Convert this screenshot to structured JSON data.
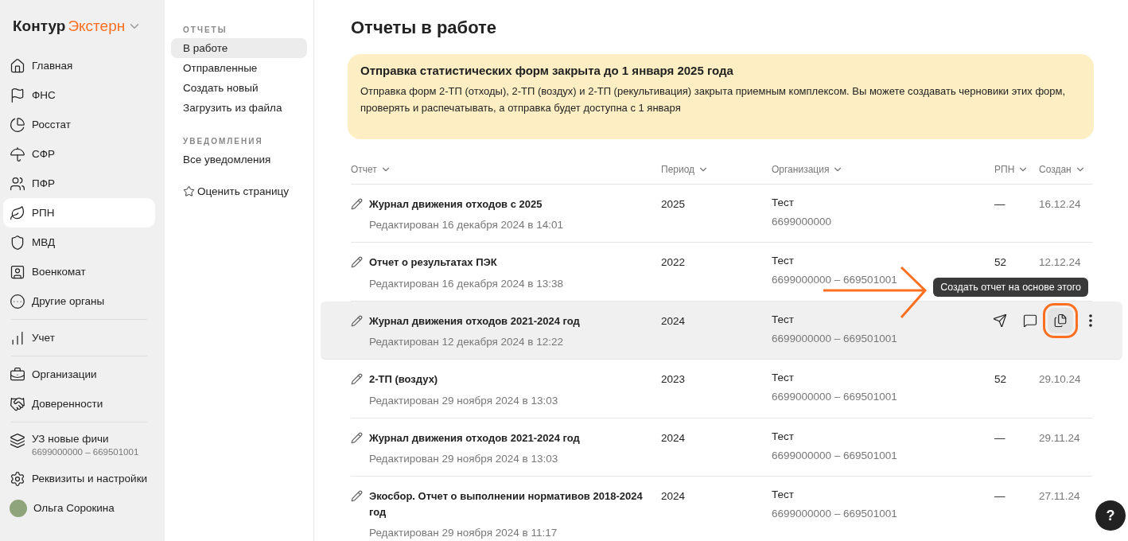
{
  "logo": {
    "brand": "Контур",
    "product": "Экстерн"
  },
  "sidebar": {
    "items": [
      {
        "kind": "link",
        "label": "Главная",
        "selected": false
      },
      {
        "kind": "link",
        "label": "ФНС",
        "selected": false
      },
      {
        "kind": "link",
        "label": "Росстат",
        "selected": false
      },
      {
        "kind": "link",
        "label": "СФР",
        "selected": false
      },
      {
        "kind": "link",
        "label": "ПФР",
        "selected": false
      },
      {
        "kind": "link",
        "label": "РПН",
        "selected": true
      },
      {
        "kind": "link",
        "label": "МВД",
        "selected": false
      },
      {
        "kind": "link",
        "label": "Военкомат",
        "selected": false
      },
      {
        "kind": "link",
        "label": "Другие органы",
        "selected": false
      },
      {
        "kind": "divider"
      },
      {
        "kind": "link",
        "label": "Учет",
        "selected": false
      },
      {
        "kind": "divider"
      },
      {
        "kind": "link",
        "label": "Организации",
        "selected": false
      },
      {
        "kind": "link",
        "label": "Доверенности",
        "selected": false
      },
      {
        "kind": "divider"
      },
      {
        "kind": "account",
        "label": "УЗ новые фичи",
        "sublabel": "6699000000 – 669501001"
      },
      {
        "kind": "link",
        "label": "Реквизиты и настройки",
        "selected": false
      },
      {
        "kind": "user",
        "label": "Ольга Сорокина"
      }
    ]
  },
  "subnav": {
    "sections": [
      {
        "heading": "ОТЧЕТЫ",
        "items": [
          {
            "label": "В работе",
            "selected": true
          },
          {
            "label": "Отправленные",
            "selected": false
          },
          {
            "label": "Создать новый",
            "selected": false
          },
          {
            "label": "Загрузить из файла",
            "selected": false
          }
        ]
      },
      {
        "heading": "УВЕДОМЛЕНИЯ",
        "items": [
          {
            "label": "Все уведомления",
            "selected": false
          }
        ]
      }
    ],
    "rate_label": "Оценить страницу"
  },
  "page_title": "Отчеты в работе",
  "banner": {
    "title": "Отправка статистических форм закрыта до 1 января 2025 года",
    "text": "Отправка форм 2-ТП (отходы), 2-ТП (воздух) и 2-ТП (рекультивация) закрыта приемным комплексом. Вы можете создавать черновики этих форм, проверять и распечатывать, а отправка будет доступна с 1 января"
  },
  "table": {
    "columns": [
      "Отчет",
      "Период",
      "Организация",
      "РПН",
      "Создан"
    ],
    "rows": [
      {
        "title": "Журнал движения отходов с 2025",
        "edited": "Редактирован 16 декабря 2024 в 14:01",
        "period": "2025",
        "org": "Тест",
        "inn": "6699000000",
        "rpn": "—",
        "created": "16.12.24",
        "hovered": false
      },
      {
        "title": "Отчет о результатах ПЭК",
        "edited": "Редактирован 16 декабря 2024 в 13:38",
        "period": "2022",
        "org": "Тест",
        "inn": "6699000000 – 669501001",
        "rpn": "52",
        "created": "12.12.24",
        "hovered": false
      },
      {
        "title": "Журнал движения отходов 2021-2024 год",
        "edited": "Редактирован 12 декабря 2024 в 12:22",
        "period": "2024",
        "org": "Тест",
        "inn": "6699000000 – 669501001",
        "rpn": "",
        "created": "",
        "hovered": true,
        "tooltip": "Создать отчет на основе этого"
      },
      {
        "title": "2-ТП (воздух)",
        "edited": "Редактирован 29 ноября 2024 в 13:03",
        "period": "2023",
        "org": "Тест",
        "inn": "6699000000 – 669501001",
        "rpn": "52",
        "created": "29.10.24",
        "hovered": false
      },
      {
        "title": "Журнал движения отходов 2021-2024 год",
        "edited": "Редактирован 29 ноября 2024 в 13:03",
        "period": "2024",
        "org": "Тест",
        "inn": "6699000000 – 669501001",
        "rpn": "—",
        "created": "29.11.24",
        "hovered": false
      },
      {
        "title": "Экосбор. Отчет о выполнении нормативов 2018-2024 год",
        "edited": "Редактирован 29 ноября 2024 в 11:17",
        "period": "2024",
        "org": "Тест",
        "inn": "6699000000 – 669501001",
        "rpn": "—",
        "created": "27.11.24",
        "hovered": false
      }
    ]
  },
  "help_label": "?"
}
